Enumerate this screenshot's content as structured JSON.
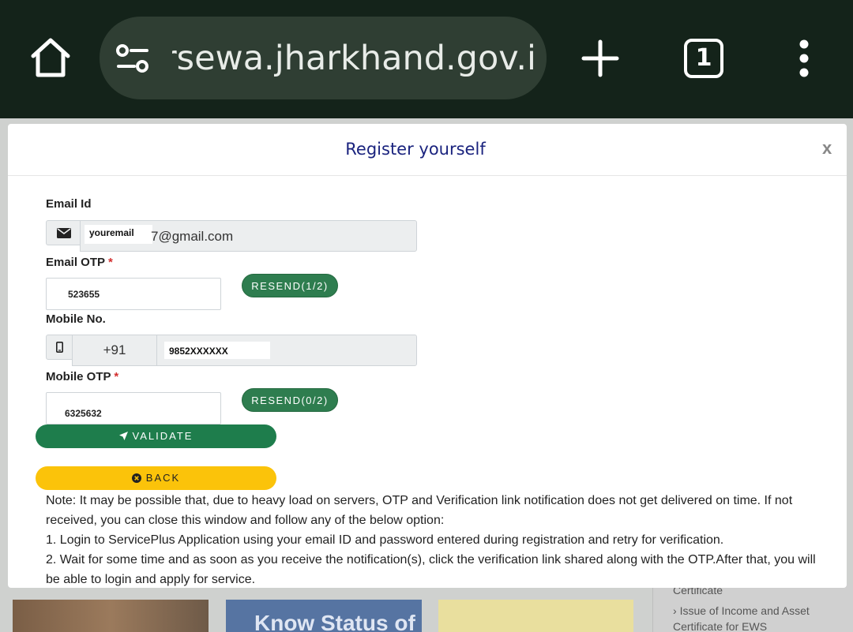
{
  "browser": {
    "url": "rsewa.jharkhand.gov.in",
    "tab_count": "1",
    "icons": [
      "home-icon",
      "site-settings-icon",
      "plus-icon",
      "tab-switcher-icon",
      "more-vert-icon"
    ]
  },
  "background": {
    "card2_text": "Know Status of",
    "side_line1": "Certificate",
    "side_line2": "Issue of Income and Asset",
    "side_line3": "Certificate for EWS"
  },
  "modal": {
    "title": "Register yourself",
    "close_label": "x",
    "email_label": "Email Id",
    "email_masked": "youremail",
    "email_suffix": "7@gmail.com",
    "email_otp_label": "Email OTP",
    "email_otp_value": "523655",
    "email_resend_label": "RESEND(1/2)",
    "mobile_label": "Mobile No.",
    "country_code": "+91",
    "mobile_value": "9852XXXXXX",
    "mobile_otp_label": "Mobile OTP",
    "mobile_otp_value": "6325632",
    "mobile_resend_label": "RESEND(0/2)",
    "required_mark": "*",
    "validate_label": "VALIDATE",
    "back_label": "BACK",
    "note_line1": "Note: It may be possible that, due to heavy load on servers, OTP and Verification link notification does not get delivered on time. If not received, you can close this window and follow any of the below option:",
    "note_line2": "1. Login to ServicePlus Application using your email ID and password entered during registration and retry for verification.",
    "note_line3": "2. Wait for some time and as soon as you receive the notification(s), click the verification link shared along with the OTP.After that, you will be able to login and apply for service."
  },
  "colors": {
    "title": "#1a237e",
    "resend": "#2e7d4f",
    "validate": "#1e7d4c",
    "back": "#fbc30a",
    "required": "#d32f2f"
  }
}
